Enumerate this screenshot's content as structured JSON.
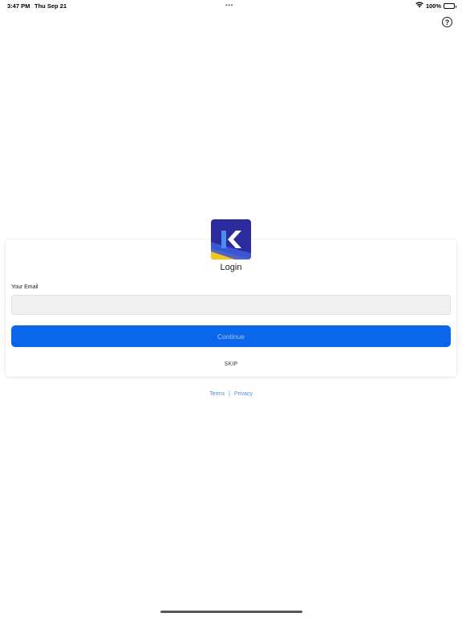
{
  "status_bar": {
    "time": "3:47 PM",
    "date": "Thu Sep 21",
    "multitask_dots": "•••",
    "battery_percent": "100%",
    "icons": [
      "wifi-icon",
      "battery-icon"
    ]
  },
  "header": {
    "help_symbol": "?",
    "help_icon": "question-circle-icon"
  },
  "login": {
    "logo_letter": "K",
    "title": "Login",
    "email_label": "Your Email",
    "email_value": "",
    "email_placeholder": "",
    "continue_label": "Continue",
    "skip_label": "SKIP"
  },
  "footer": {
    "terms_label": "Terms",
    "separator": "|",
    "privacy_label": "Privacy"
  },
  "colors": {
    "primary_button": "#0a66ea",
    "link": "#4a90d9",
    "logo_background": "#2b2b9e",
    "logo_accent": "#f5c518"
  }
}
